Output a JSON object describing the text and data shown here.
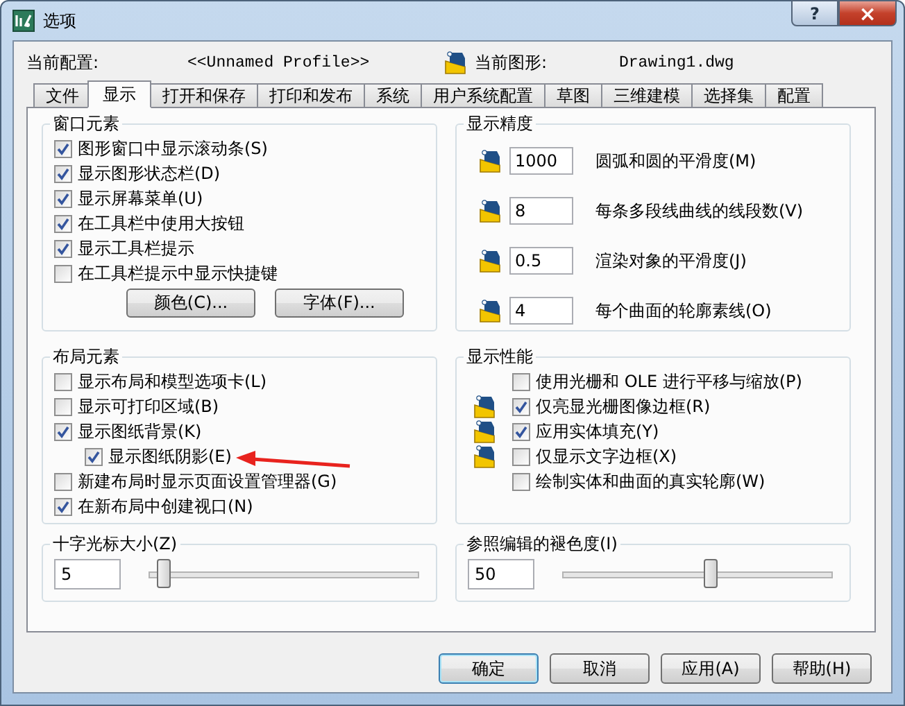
{
  "window": {
    "title": "选项",
    "help_button": "?",
    "close_button": "×"
  },
  "profile": {
    "label": "当前配置:",
    "value": "<<Unnamed Profile>>"
  },
  "drawing": {
    "label": "当前图形:",
    "value": "Drawing1.dwg"
  },
  "tabs": [
    {
      "label": "文件",
      "selected": false
    },
    {
      "label": "显示",
      "selected": true
    },
    {
      "label": "打开和保存",
      "selected": false
    },
    {
      "label": "打印和发布",
      "selected": false
    },
    {
      "label": "系统",
      "selected": false
    },
    {
      "label": "用户系统配置",
      "selected": false
    },
    {
      "label": "草图",
      "selected": false
    },
    {
      "label": "三维建模",
      "selected": false
    },
    {
      "label": "选择集",
      "selected": false
    },
    {
      "label": "配置",
      "selected": false
    }
  ],
  "window_elements": {
    "title": "窗口元素",
    "options": [
      {
        "label": "图形窗口中显示滚动条(S)",
        "checked": true
      },
      {
        "label": "显示图形状态栏(D)",
        "checked": true
      },
      {
        "label": "显示屏幕菜单(U)",
        "checked": true
      },
      {
        "label": "在工具栏中使用大按钮",
        "checked": true
      },
      {
        "label": "显示工具栏提示",
        "checked": true
      },
      {
        "label": "在工具栏提示中显示快捷键",
        "checked": false
      }
    ],
    "buttons": [
      "颜色(C)...",
      "字体(F)..."
    ]
  },
  "display_resolution": {
    "title": "显示精度",
    "rows": [
      {
        "value": "1000",
        "label": "圆弧和圆的平滑度(M)",
        "saved_in_drawing": true
      },
      {
        "value": "8",
        "label": "每条多段线曲线的线段数(V)",
        "saved_in_drawing": true
      },
      {
        "value": "0.5",
        "label": "渲染对象的平滑度(J)",
        "saved_in_drawing": true
      },
      {
        "value": "4",
        "label": "每个曲面的轮廓素线(O)",
        "saved_in_drawing": true
      }
    ]
  },
  "layout_elements": {
    "title": "布局元素",
    "options": [
      {
        "label": "显示布局和模型选项卡(L)",
        "checked": false
      },
      {
        "label": "显示可打印区域(B)",
        "checked": false
      },
      {
        "label": "显示图纸背景(K)",
        "checked": true,
        "children": [
          {
            "label": "显示图纸阴影(E)",
            "checked": true
          }
        ]
      },
      {
        "label": "新建布局时显示页面设置管理器(G)",
        "checked": false
      },
      {
        "label": "在新布局中创建视口(N)",
        "checked": true
      }
    ]
  },
  "display_performance": {
    "title": "显示性能",
    "options": [
      {
        "label": "使用光栅和 OLE 进行平移与缩放(P)",
        "checked": false,
        "saved_in_drawing": false
      },
      {
        "label": "仅亮显光栅图像边框(R)",
        "checked": true,
        "saved_in_drawing": true
      },
      {
        "label": "应用实体填充(Y)",
        "checked": true,
        "saved_in_drawing": true
      },
      {
        "label": "仅显示文字边框(X)",
        "checked": false,
        "saved_in_drawing": true
      },
      {
        "label": "绘制实体和曲面的真实轮廓(W)",
        "checked": false,
        "saved_in_drawing": false
      }
    ]
  },
  "crosshair_size": {
    "title": "十字光标大小(Z)",
    "value": "5",
    "level": 0.05
  },
  "xref_fade": {
    "title": "参照编辑的褪色度(I)",
    "value": "50",
    "level": 0.55
  },
  "buttons": [
    {
      "label": "确定",
      "default": true
    },
    {
      "label": "取消",
      "default": false
    },
    {
      "label": "应用(A)",
      "default": false
    },
    {
      "label": "帮助(H)",
      "default": false
    }
  ]
}
